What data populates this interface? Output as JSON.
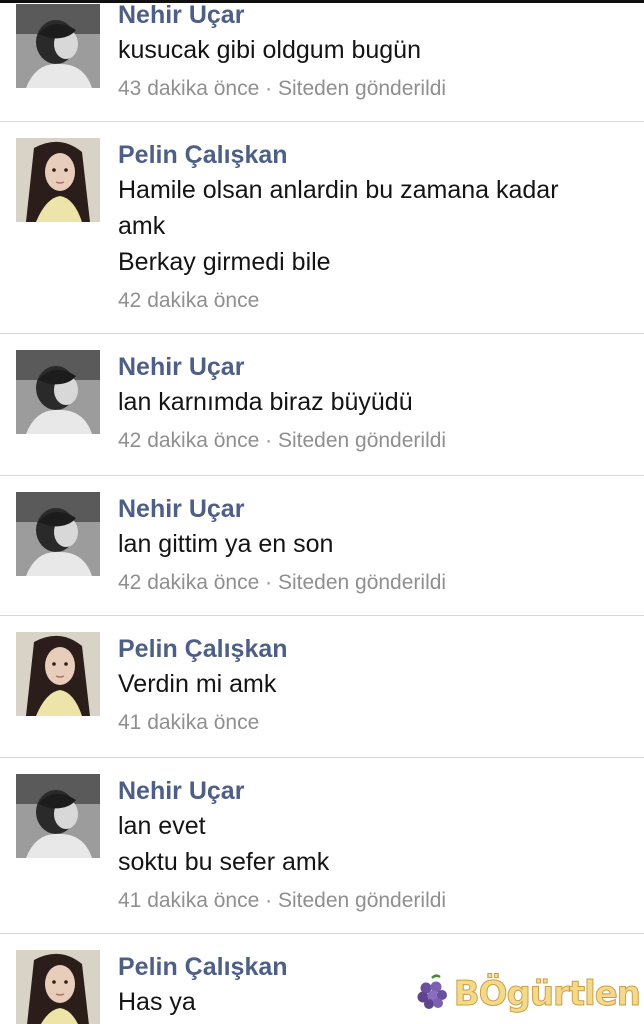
{
  "comments": [
    {
      "author": "Nehir Uçar",
      "lines": [
        "kusucak gibi oldgum bugün"
      ],
      "time": "43 dakika önce",
      "source": "Siteden gönderildi"
    },
    {
      "author": "Pelin Çalışkan",
      "lines": [
        "Hamile olsan anlardin bu zamana kadar",
        "amk",
        "Berkay girmedi bile"
      ],
      "time": "42 dakika önce",
      "source": ""
    },
    {
      "author": "Nehir Uçar",
      "lines": [
        "lan karnımda biraz büyüdü"
      ],
      "time": "42 dakika önce",
      "source": "Siteden gönderildi"
    },
    {
      "author": "Nehir Uçar",
      "lines": [
        "lan gittim ya en son"
      ],
      "time": "42 dakika önce",
      "source": "Siteden gönderildi"
    },
    {
      "author": "Pelin Çalışkan",
      "lines": [
        "Verdin mi amk"
      ],
      "time": "41 dakika önce",
      "source": ""
    },
    {
      "author": "Nehir Uçar",
      "lines": [
        "lan evet",
        "soktu bu sefer amk"
      ],
      "time": "41 dakika önce",
      "source": "Siteden gönderildi"
    },
    {
      "author": "Pelin Çalışkan",
      "lines": [
        "Has ya"
      ],
      "time": "",
      "source": ""
    }
  ],
  "meta_separator": " · ",
  "watermark": {
    "text": "BÖgürtlen",
    "icon": "blackberry-icon",
    "color": "#f4d98a"
  }
}
